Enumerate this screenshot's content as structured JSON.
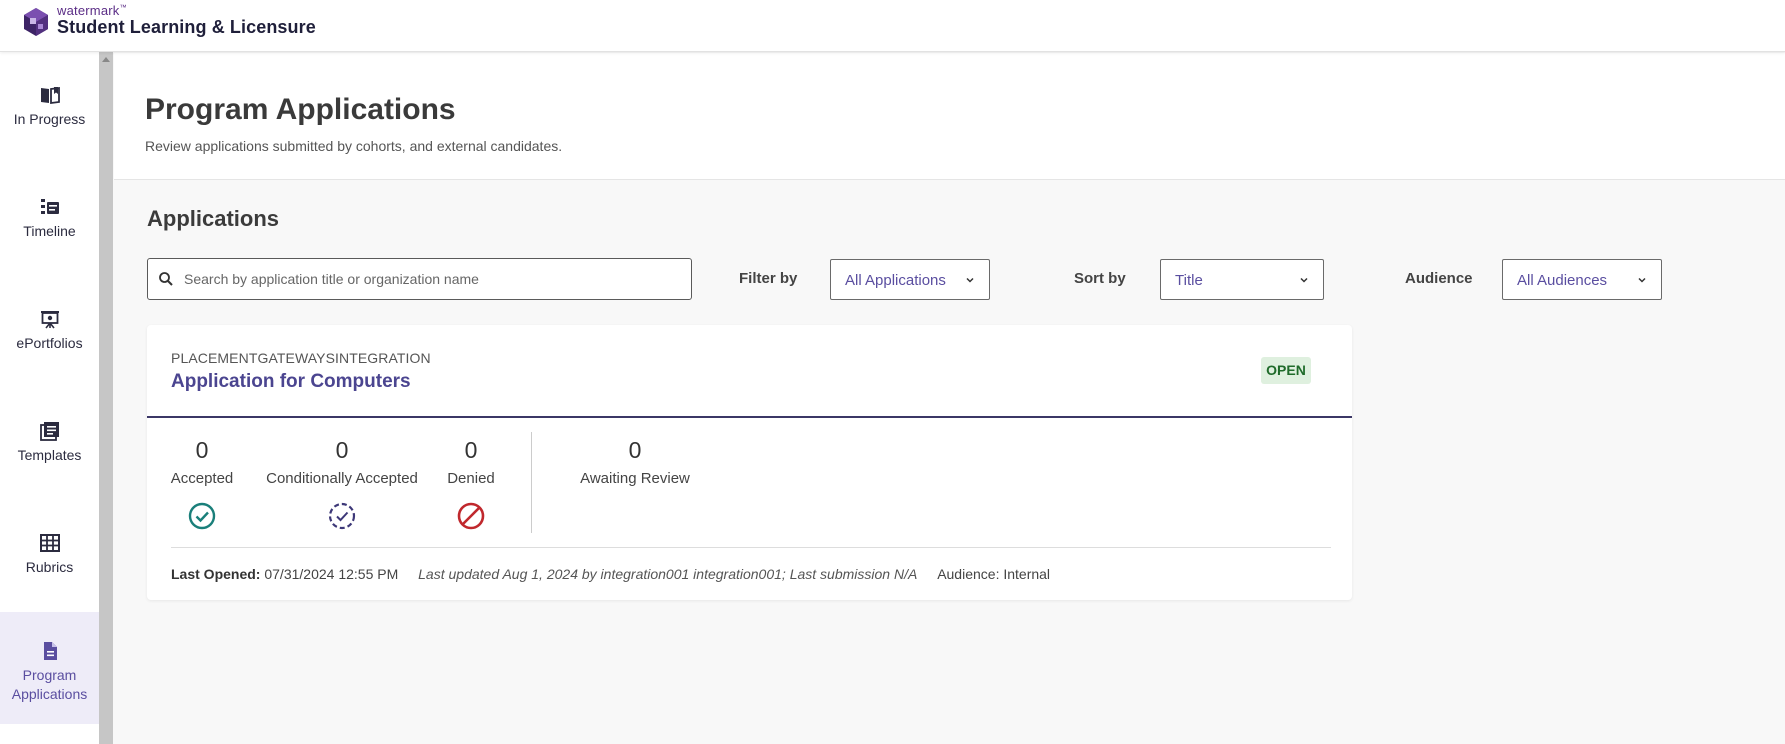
{
  "header": {
    "brand_small": "watermark",
    "brand_tm": "™",
    "brand_main": "Student Learning & Licensure"
  },
  "sidebar": {
    "items": [
      {
        "label": "In Progress",
        "icon": "book-icon"
      },
      {
        "label": "Timeline",
        "icon": "timeline-icon"
      },
      {
        "label": "ePortfolios",
        "icon": "presentation-icon"
      },
      {
        "label": "Templates",
        "icon": "templates-icon"
      },
      {
        "label": "Rubrics",
        "icon": "grid-icon"
      },
      {
        "label": "Program Applications",
        "icon": "document-icon",
        "active": true
      }
    ]
  },
  "page": {
    "title": "Program Applications",
    "subtitle": "Review applications submitted by cohorts, and external candidates."
  },
  "applications": {
    "section_title": "Applications",
    "search_placeholder": "Search by application title or organization name",
    "filter_label": "Filter by",
    "filter_value": "All Applications",
    "sort_label": "Sort by",
    "sort_value": "Title",
    "audience_label": "Audience",
    "audience_value": "All Audiences"
  },
  "card": {
    "org": "PLACEMENTGATEWAYSINTEGRATION",
    "title": "Application for Computers",
    "status": "OPEN",
    "stats": {
      "accepted": {
        "value": "0",
        "label": "Accepted"
      },
      "conditional": {
        "value": "0",
        "label": "Conditionally Accepted"
      },
      "denied": {
        "value": "0",
        "label": "Denied"
      },
      "awaiting": {
        "value": "0",
        "label": "Awaiting Review"
      }
    },
    "last_opened_label": "Last Opened:",
    "last_opened_value": "07/31/2024 12:55 PM",
    "last_updated": "Last updated Aug 1, 2024 by integration001 integration001; Last submission N/A",
    "audience": "Audience: Internal"
  },
  "colors": {
    "accent": "#5a4ea0",
    "brand": "#5b2d86",
    "open_bg": "#dff0df",
    "open_text": "#1f6b2a",
    "accepted": "#1a7f7a",
    "denied": "#c0282d"
  }
}
